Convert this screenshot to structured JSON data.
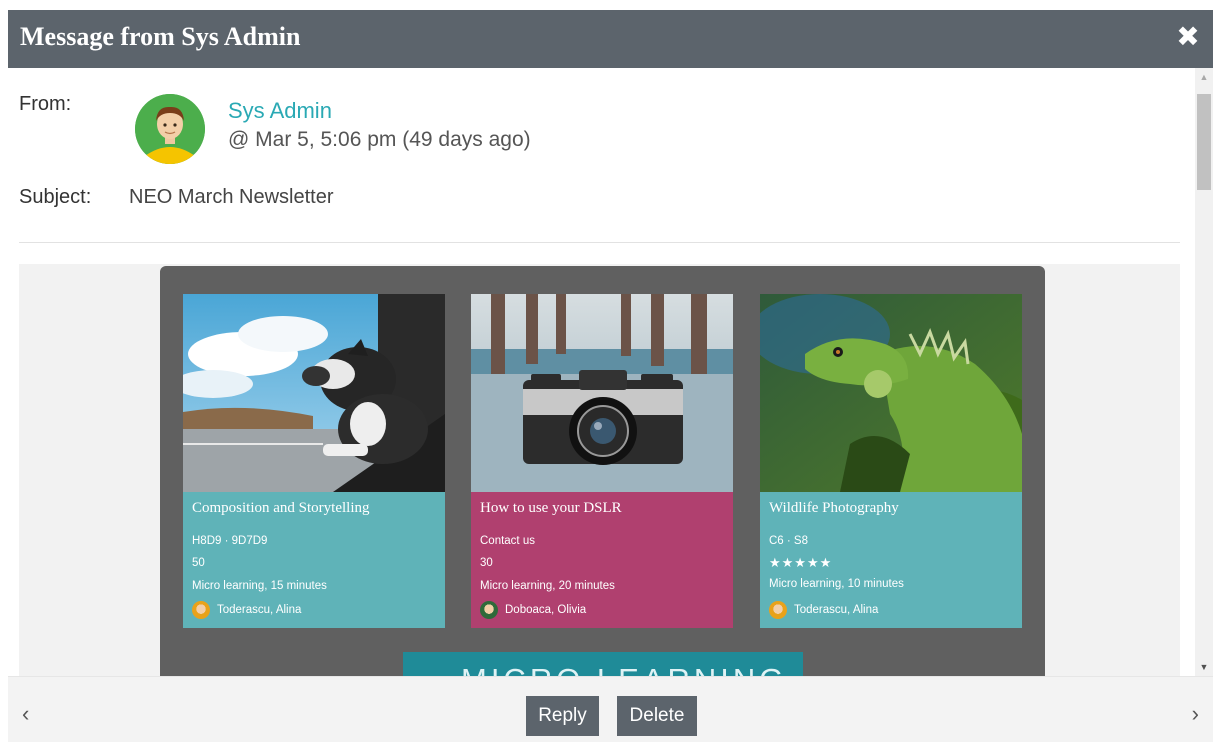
{
  "dialog": {
    "title": "Message from Sys Admin",
    "close_icon": "close-icon"
  },
  "message": {
    "from_label": "From:",
    "sender_name": "Sys Admin",
    "datetime": "@ Mar 5, 5:06 pm (49 days ago)",
    "subject_label": "Subject:",
    "subject": "NEO March Newsletter"
  },
  "newsletter": {
    "cards": [
      {
        "title": "Composition and Storytelling",
        "line1": "H8D9 · 9D7D9",
        "line2": "50",
        "line3": "Micro learning, 15 minutes",
        "author": "Toderascu, Alina",
        "color": "#5fb3b8"
      },
      {
        "title": "How to use your DSLR",
        "line1": "Contact us",
        "line2": "30",
        "line3": "Micro learning, 20 minutes",
        "author": "Doboaca, Olivia",
        "color": "#b0406f"
      },
      {
        "title": "Wildlife Photography",
        "line1": "C6 · S8",
        "rating_stars": "★★★★★",
        "rating": 5,
        "line3": "Micro learning, 10 minutes",
        "author": "Toderascu, Alina",
        "color": "#5fb3b8"
      }
    ],
    "banner_text": "MICRO LEARNING"
  },
  "footer": {
    "prev_label": "‹",
    "next_label": "›",
    "reply_label": "Reply",
    "delete_label": "Delete"
  },
  "colors": {
    "titlebar": "#5c646c",
    "accent": "#2aa9b4",
    "teal_card": "#5fb3b8",
    "magenta_card": "#b0406f"
  }
}
